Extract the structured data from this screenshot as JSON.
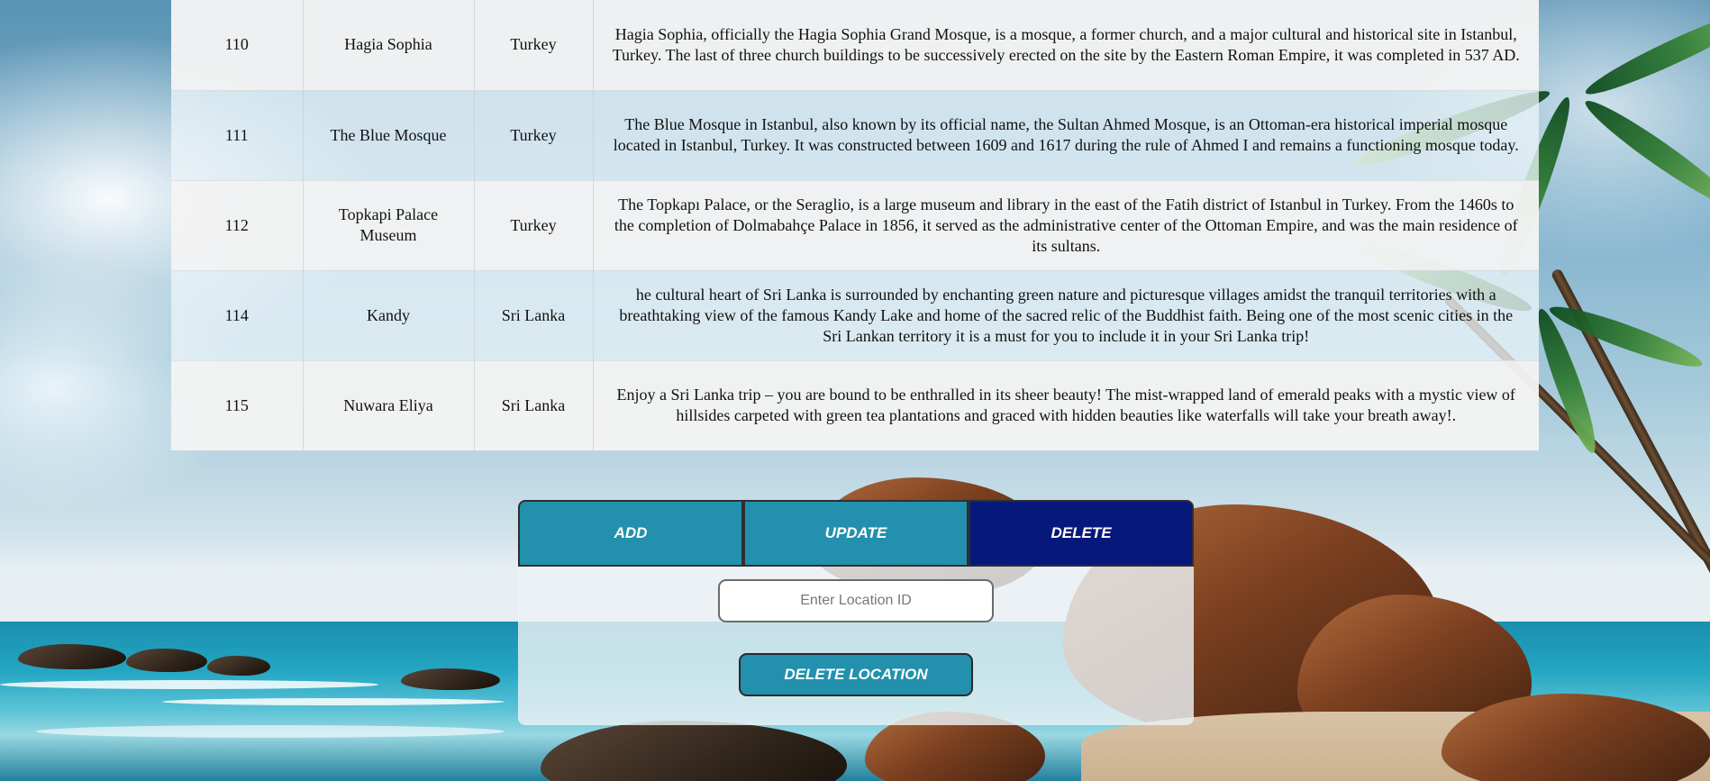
{
  "table": {
    "rows": [
      {
        "id": "110",
        "name": "Hagia Sophia",
        "country": "Turkey",
        "description": "Hagia Sophia, officially the Hagia Sophia Grand Mosque, is a mosque, a former church, and a major cultural and historical site in Istanbul, Turkey. The last of three church buildings to be successively erected on the site by the Eastern Roman Empire, it was completed in 537 AD."
      },
      {
        "id": "111",
        "name": "The Blue Mosque",
        "country": "Turkey",
        "description": "The Blue Mosque in Istanbul, also known by its official name, the Sultan Ahmed Mosque, is an Ottoman-era historical imperial mosque located in Istanbul, Turkey. It was constructed between 1609 and 1617 during the rule of Ahmed I and remains a functioning mosque today."
      },
      {
        "id": "112",
        "name": "Topkapi Palace Museum",
        "country": "Turkey",
        "description": "The Topkapı Palace, or the Seraglio, is a large museum and library in the east of the Fatih district of Istanbul in Turkey. From the 1460s to the completion of Dolmabahçe Palace in 1856, it served as the administrative center of the Ottoman Empire, and was the main residence of its sultans."
      },
      {
        "id": "114",
        "name": "Kandy",
        "country": "Sri Lanka",
        "description": "he cultural heart of Sri Lanka is surrounded by enchanting green nature and picturesque villages amidst the tranquil territories with a breathtaking view of the famous Kandy Lake and home of the sacred relic of the Buddhist faith. Being one of the most scenic cities in the Sri Lankan territory it is a must for you to include it in your Sri Lanka trip!"
      },
      {
        "id": "115",
        "name": "Nuwara Eliya",
        "country": "Sri Lanka",
        "description": "Enjoy a Sri Lanka trip – you are bound to be enthralled in its sheer beauty! The mist-wrapped land of emerald peaks with a mystic view of hillsides carpeted with green tea plantations and graced with hidden beauties like waterfalls will take your breath away!."
      }
    ]
  },
  "form": {
    "tabs": [
      {
        "label": "ADD"
      },
      {
        "label": "UPDATE"
      },
      {
        "label": "DELETE"
      }
    ],
    "active_tab": "DELETE",
    "location_id": {
      "value": "",
      "placeholder": "Enter Location ID"
    },
    "submit_label": "DELETE LOCATION"
  },
  "colors": {
    "tab": "#2390ad",
    "tab_active": "#06187a",
    "button": "#2390ad"
  }
}
